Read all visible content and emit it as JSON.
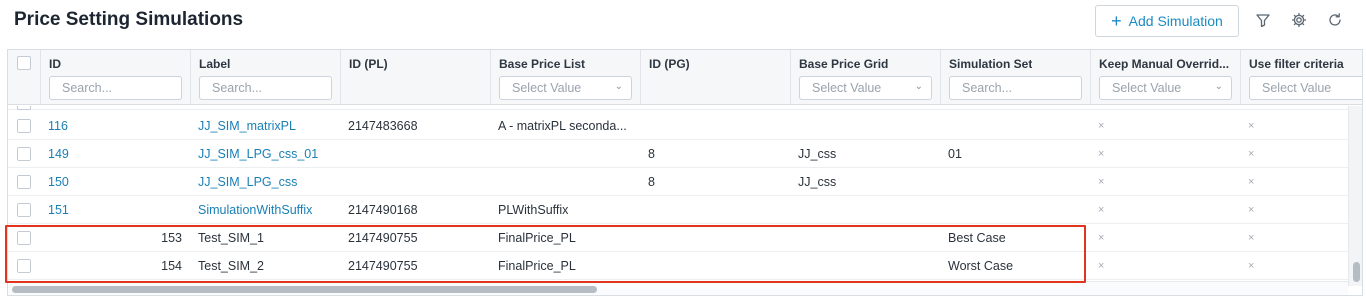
{
  "page": {
    "title": "Price Setting Simulations"
  },
  "toolbar": {
    "add_button_label": "Add Simulation",
    "add_icon": "+",
    "icons": [
      "filter-icon",
      "gear-icon",
      "refresh-icon"
    ]
  },
  "grid": {
    "columns": [
      {
        "label": "",
        "filter": ""
      },
      {
        "label": "ID",
        "filter": "Search..."
      },
      {
        "label": "Label",
        "filter": "Search..."
      },
      {
        "label": "ID (PL)",
        "filter": ""
      },
      {
        "label": "Base Price List",
        "filter": "Select Value"
      },
      {
        "label": "ID (PG)",
        "filter": ""
      },
      {
        "label": "Base Price Grid",
        "filter": "Select Value"
      },
      {
        "label": "Simulation Set",
        "filter": "Search..."
      },
      {
        "label": "Keep Manual Overrid...",
        "filter": "Select Value"
      },
      {
        "label": "Use filter criteria",
        "filter": "Select Value"
      }
    ],
    "rows": [
      {
        "id": "116",
        "label": "JJ_SIM_matrixPL",
        "id_pl": "2147483668",
        "base_price_list": "A - matrixPL seconda...",
        "id_pg": "",
        "base_price_grid": "",
        "simulation_set": "",
        "keep_manual": "×",
        "use_filter": "×"
      },
      {
        "id": "149",
        "label": "JJ_SIM_LPG_css_01",
        "id_pl": "",
        "base_price_list": "",
        "id_pg": "8",
        "base_price_grid": "JJ_css",
        "simulation_set": "01",
        "keep_manual": "×",
        "use_filter": "×"
      },
      {
        "id": "150",
        "label": "JJ_SIM_LPG_css",
        "id_pl": "",
        "base_price_list": "",
        "id_pg": "8",
        "base_price_grid": "JJ_css",
        "simulation_set": "",
        "keep_manual": "×",
        "use_filter": "×"
      },
      {
        "id": "151",
        "label": "SimulationWithSuffix",
        "id_pl": "2147490168",
        "base_price_list": "PLWithSuffix",
        "id_pg": "",
        "base_price_grid": "",
        "simulation_set": "",
        "keep_manual": "×",
        "use_filter": "×"
      },
      {
        "id": "153",
        "label": "Test_SIM_1",
        "id_pl": "2147490755",
        "base_price_list": "FinalPrice_PL",
        "id_pg": "",
        "base_price_grid": "",
        "simulation_set": "Best Case",
        "keep_manual": "×",
        "use_filter": "×"
      },
      {
        "id": "154",
        "label": "Test_SIM_2",
        "id_pl": "2147490755",
        "base_price_list": "FinalPrice_PL",
        "id_pg": "",
        "base_price_grid": "",
        "simulation_set": "Worst Case",
        "keep_manual": "×",
        "use_filter": "×"
      }
    ]
  },
  "colors": {
    "accent": "#1c8bc3",
    "highlight": "#e0341f"
  }
}
